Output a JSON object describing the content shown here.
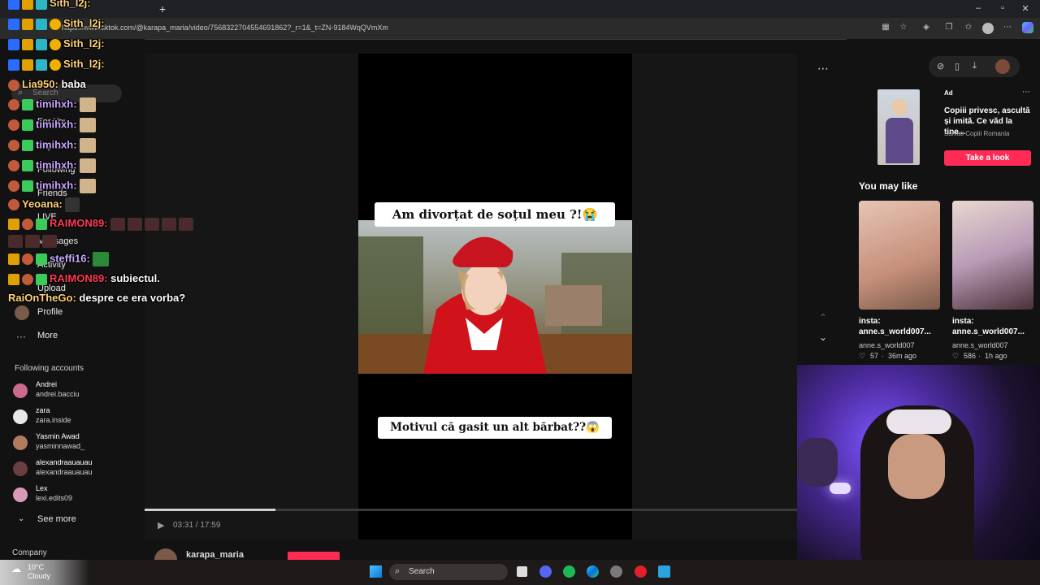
{
  "browser": {
    "url": "https://www.tiktok.com/@karapa_maria/video/7568322704554691862?_r=1&_t=ZN-9184WqQVmXm",
    "new_tab": "+"
  },
  "sidebar": {
    "search_placeholder": "Search",
    "nav": [
      "For You",
      "Explore",
      "Following",
      "Friends",
      "LIVE",
      "Messages",
      "Activity",
      "Upload",
      "Profile",
      "More"
    ],
    "following_header": "Following accounts",
    "accounts": [
      {
        "name": "Andrei",
        "handle": "andrei.bacciu",
        "color": "#c96a8e"
      },
      {
        "name": "zara",
        "handle": "zara.inside",
        "color": "#e8e8e8"
      },
      {
        "name": "Yasmin Awad",
        "handle": "yasminnawad_",
        "color": "#b07a5e"
      },
      {
        "name": "alexandraauauau",
        "handle": "alexandraauauau",
        "color": "#6a3f3f"
      },
      {
        "name": "Lex",
        "handle": "lexi.edits09",
        "color": "#d99ab9"
      }
    ],
    "see_more": "See more",
    "company": "Company"
  },
  "video": {
    "caption_top": "Am divorțat de soțul meu ?!😭",
    "caption_bottom": "Motivul că gasit un alt bărbat??😱",
    "time": "03:31 / 17:59",
    "progress": 0.2,
    "author": "karapa_maria"
  },
  "right": {
    "ad_label": "Ad",
    "ad_title": "Copiii privesc, ascultă și imită. Ce văd la tine...",
    "ad_sponsor": "Salvati Copiii Romania",
    "ad_cta": "Take a look",
    "you_may_like": "You may like",
    "recs": [
      {
        "title": "insta: anne.s_world007...",
        "user": "anne.s_world007",
        "likes": "57",
        "age": "36m ago"
      },
      {
        "title": "insta: anne.s_world007...",
        "user": "anne.s_world007",
        "likes": "586",
        "age": "1h ago"
      }
    ]
  },
  "chat": [
    {
      "user": "Sith_l2j:",
      "msg": "",
      "color": "#ffd27a"
    },
    {
      "user": "Sith_l2j:",
      "msg": "",
      "color": "#ffd27a"
    },
    {
      "user": "Sith_l2j:",
      "msg": "",
      "color": "#ffd27a"
    },
    {
      "user": "Sith_l2j:",
      "msg": "",
      "color": "#ffd27a"
    },
    {
      "user": "Lia950:",
      "msg": "baba",
      "color": "#ffd27a"
    },
    {
      "user": "timihxh:",
      "msg": "",
      "color": "#c9a6ff"
    },
    {
      "user": "timihxh:",
      "msg": "",
      "color": "#c9a6ff"
    },
    {
      "user": "timihxh:",
      "msg": "",
      "color": "#c9a6ff"
    },
    {
      "user": "timihxh:",
      "msg": "",
      "color": "#c9a6ff"
    },
    {
      "user": "timihxh:",
      "msg": "",
      "color": "#c9a6ff"
    },
    {
      "user": "Yeoana:",
      "msg": "",
      "color": "#ffd27a"
    },
    {
      "user": "RAIMON89:",
      "msg": "",
      "color": "#ff3b57"
    },
    {
      "user": "steffi16:",
      "msg": "",
      "color": "#c9a6ff"
    },
    {
      "user": "RAIMON89:",
      "msg": "subiectul.",
      "color": "#ff3b57"
    },
    {
      "user": "RaiOnTheGo:",
      "msg": "despre ce era vorba?",
      "color": "#ffd27a"
    }
  ],
  "taskbar": {
    "weather_temp": "10°C",
    "weather_cond": "Cloudy",
    "search": "Search"
  }
}
